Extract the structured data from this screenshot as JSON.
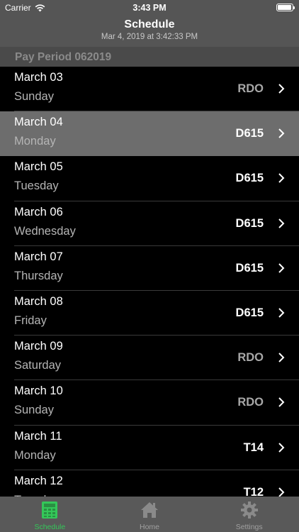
{
  "status_bar": {
    "carrier": "Carrier",
    "time": "3:43 PM"
  },
  "nav": {
    "title": "Schedule",
    "subtitle": "Mar 4, 2019 at 3:42:33 PM"
  },
  "section": {
    "title": "Pay Period 062019"
  },
  "rows": [
    {
      "date": "March 03",
      "day": "Sunday",
      "code": "RDO",
      "off": true
    },
    {
      "date": "March 04",
      "day": "Monday",
      "code": "D615",
      "off": false,
      "selected": true
    },
    {
      "date": "March 05",
      "day": "Tuesday",
      "code": "D615",
      "off": false
    },
    {
      "date": "March 06",
      "day": "Wednesday",
      "code": "D615",
      "off": false
    },
    {
      "date": "March 07",
      "day": "Thursday",
      "code": "D615",
      "off": false
    },
    {
      "date": "March 08",
      "day": "Friday",
      "code": "D615",
      "off": false
    },
    {
      "date": "March 09",
      "day": "Saturday",
      "code": "RDO",
      "off": true
    },
    {
      "date": "March 10",
      "day": "Sunday",
      "code": "RDO",
      "off": true
    },
    {
      "date": "March 11",
      "day": "Monday",
      "code": "T14",
      "off": false
    },
    {
      "date": "March 12",
      "day": "Tuesday",
      "code": "T12",
      "off": false
    }
  ],
  "tabs": [
    {
      "label": "Schedule",
      "icon": "calculator-icon",
      "active": true
    },
    {
      "label": "Home",
      "icon": "home-icon",
      "active": false
    },
    {
      "label": "Settings",
      "icon": "gear-icon",
      "active": false
    }
  ],
  "colors": {
    "accent": "#34c759",
    "bar_background": "#555555",
    "selected_row": "#6d6d6d"
  }
}
